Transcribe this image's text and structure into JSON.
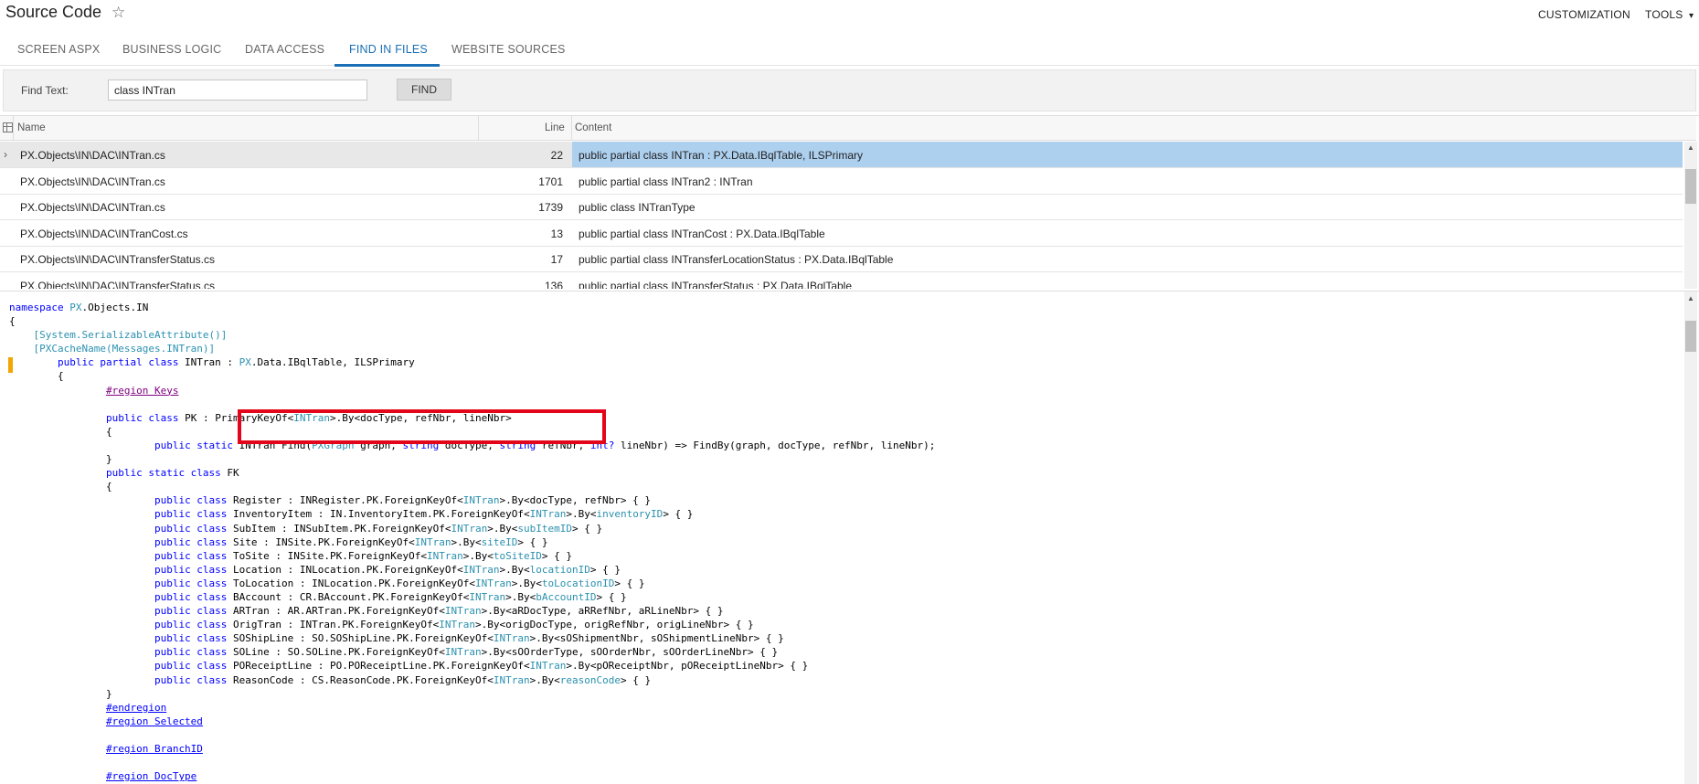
{
  "header": {
    "title": "Source Code",
    "star_icon": "star-outline-icon",
    "customization_label": "CUSTOMIZATION",
    "tools_label": "TOOLS",
    "tools_caret": "▾"
  },
  "tabs": [
    {
      "label": "SCREEN ASPX",
      "active": false
    },
    {
      "label": "BUSINESS LOGIC",
      "active": false
    },
    {
      "label": "DATA ACCESS",
      "active": false
    },
    {
      "label": "FIND IN FILES",
      "active": true
    },
    {
      "label": "WEBSITE SOURCES",
      "active": false
    }
  ],
  "find": {
    "label": "Find Text:",
    "value": "class INTran",
    "button_label": "FIND"
  },
  "grid": {
    "columns": [
      "Name",
      "Line",
      "Content"
    ],
    "rows": [
      {
        "name": "PX.Objects\\IN\\DAC\\INTran.cs",
        "line": "22",
        "content": "public partial class INTran : PX.Data.IBqlTable, ILSPrimary",
        "selected": true
      },
      {
        "name": "PX.Objects\\IN\\DAC\\INTran.cs",
        "line": "1701",
        "content": "public partial class INTran2 : INTran",
        "selected": false
      },
      {
        "name": "PX.Objects\\IN\\DAC\\INTran.cs",
        "line": "1739",
        "content": "public class INTranType",
        "selected": false
      },
      {
        "name": "PX.Objects\\IN\\DAC\\INTranCost.cs",
        "line": "13",
        "content": "public partial class INTranCost : PX.Data.IBqlTable",
        "selected": false
      },
      {
        "name": "PX.Objects\\IN\\DAC\\INTransferStatus.cs",
        "line": "17",
        "content": "public partial class INTransferLocationStatus : PX.Data.IBqlTable",
        "selected": false
      },
      {
        "name": "PX.Objects\\IN\\DAC\\INTransferStatus.cs",
        "line": "136",
        "content": "public partial class INTransferStatus : PX.Data.IBqlTable",
        "selected": false
      }
    ]
  },
  "colors": {
    "accent": "#1a6fb5",
    "selected_row": "#aed0ef",
    "highlight_box": "#e3061b",
    "gutter_marker": "#f3a500"
  }
}
